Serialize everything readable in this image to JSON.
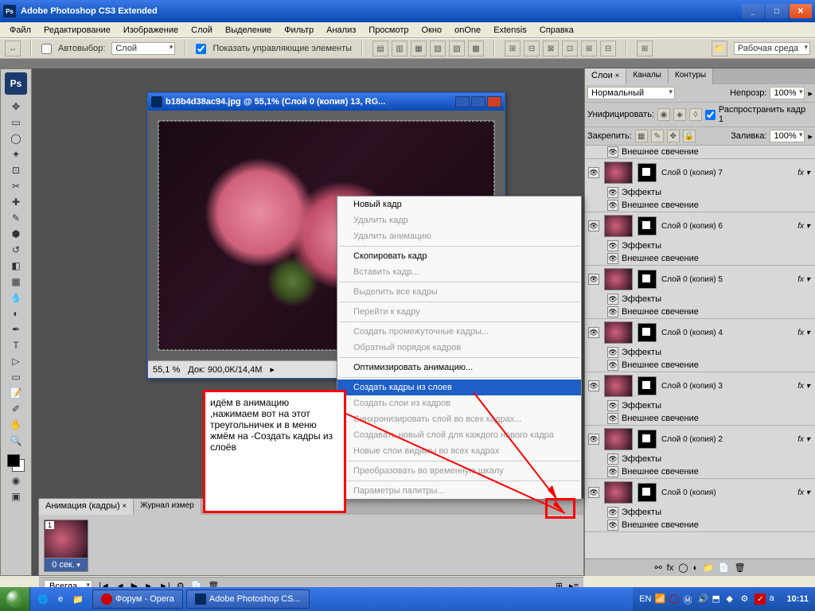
{
  "app": {
    "title": "Adobe Photoshop CS3 Extended",
    "logo": "Ps"
  },
  "menu": [
    "Файл",
    "Редактирование",
    "Изображение",
    "Слой",
    "Выделение",
    "Фильтр",
    "Анализ",
    "Просмотр",
    "Окно",
    "onOne",
    "Extensis",
    "Справка"
  ],
  "optbar": {
    "auto_select": "Автовыбор:",
    "auto_select_mode": "Слой",
    "show_controls": "Показать управляющие элементы",
    "workspace_btn": "Рабочая среда"
  },
  "doc": {
    "title": "b18b4d38ac94.jpg @ 55,1% (Слой 0 (копия) 13, RG...",
    "zoom": "55,1 %",
    "info": "Док: 900,0K/14,4M"
  },
  "anim": {
    "tab1": "Анимация (кадры)",
    "tab2": "Журнал измер",
    "frame_number": "1",
    "frame_time": "0 сек.",
    "loop": "Всегда"
  },
  "layers_panel": {
    "tab_layers": "Слои",
    "tab_channels": "Каналы",
    "tab_paths": "Контуры",
    "blend": "Нормальный",
    "opacity_label": "Непрозр:",
    "opacity": "100%",
    "unify": "Унифицировать:",
    "propagate": "Распространить кадр 1",
    "lock": "Закрепить:",
    "fill_label": "Заливка:",
    "fill": "100%",
    "fx_label": "fx",
    "effects_label": "Эффекты",
    "outer_glow": "Внешнее свечение",
    "layers": [
      "Слой 0 (копия) 7",
      "Слой 0 (копия) 6",
      "Слой 0 (копия) 5",
      "Слой 0 (копия) 4",
      "Слой 0 (копия) 3",
      "Слой 0 (копия) 2",
      "Слой 0 (копия)"
    ]
  },
  "context_menu": [
    {
      "t": "Новый кадр",
      "d": false
    },
    {
      "t": "Удалить кадр",
      "d": true
    },
    {
      "t": "Удалить анимацию",
      "d": true
    },
    {
      "sep": true
    },
    {
      "t": "Скопировать кадр",
      "d": false
    },
    {
      "t": "Вставить кадр...",
      "d": true
    },
    {
      "sep": true
    },
    {
      "t": "Выделить все кадры",
      "d": true
    },
    {
      "sep": true
    },
    {
      "t": "Перейти к кадру",
      "d": true
    },
    {
      "sep": true
    },
    {
      "t": "Создать промежуточные кадры...",
      "d": true
    },
    {
      "t": "Обратный порядок кадров",
      "d": true
    },
    {
      "sep": true
    },
    {
      "t": "Оптимизировать анимацию...",
      "d": false
    },
    {
      "sep": true
    },
    {
      "t": "Создать кадры из слоев",
      "d": false,
      "sel": true
    },
    {
      "t": "Создать слои из кадров",
      "d": false,
      "grey": true
    },
    {
      "t": "Синхронизировать слой во всех кадрах...",
      "d": true,
      "grey": true
    },
    {
      "t": "Создавать новый слой для каждого нового кадра",
      "d": false,
      "grey": true
    },
    {
      "t": "Новые слои видимы во всех кадрах",
      "d": false,
      "grey": true
    },
    {
      "sep": true
    },
    {
      "t": "Преобразовать во временную шкалу",
      "d": false,
      "grey": true
    },
    {
      "sep": true
    },
    {
      "t": "Параметры палитры...",
      "d": false,
      "grey": true
    }
  ],
  "annotation": "идём в анимацию ,нажимаем вот на этот треугольничек и в меню жмём на -Создать кадры из слоёв",
  "taskbar": {
    "task1": "Форум - Opera",
    "task2": "Adobe Photoshop CS...",
    "lang": "EN",
    "time": "10:11"
  }
}
